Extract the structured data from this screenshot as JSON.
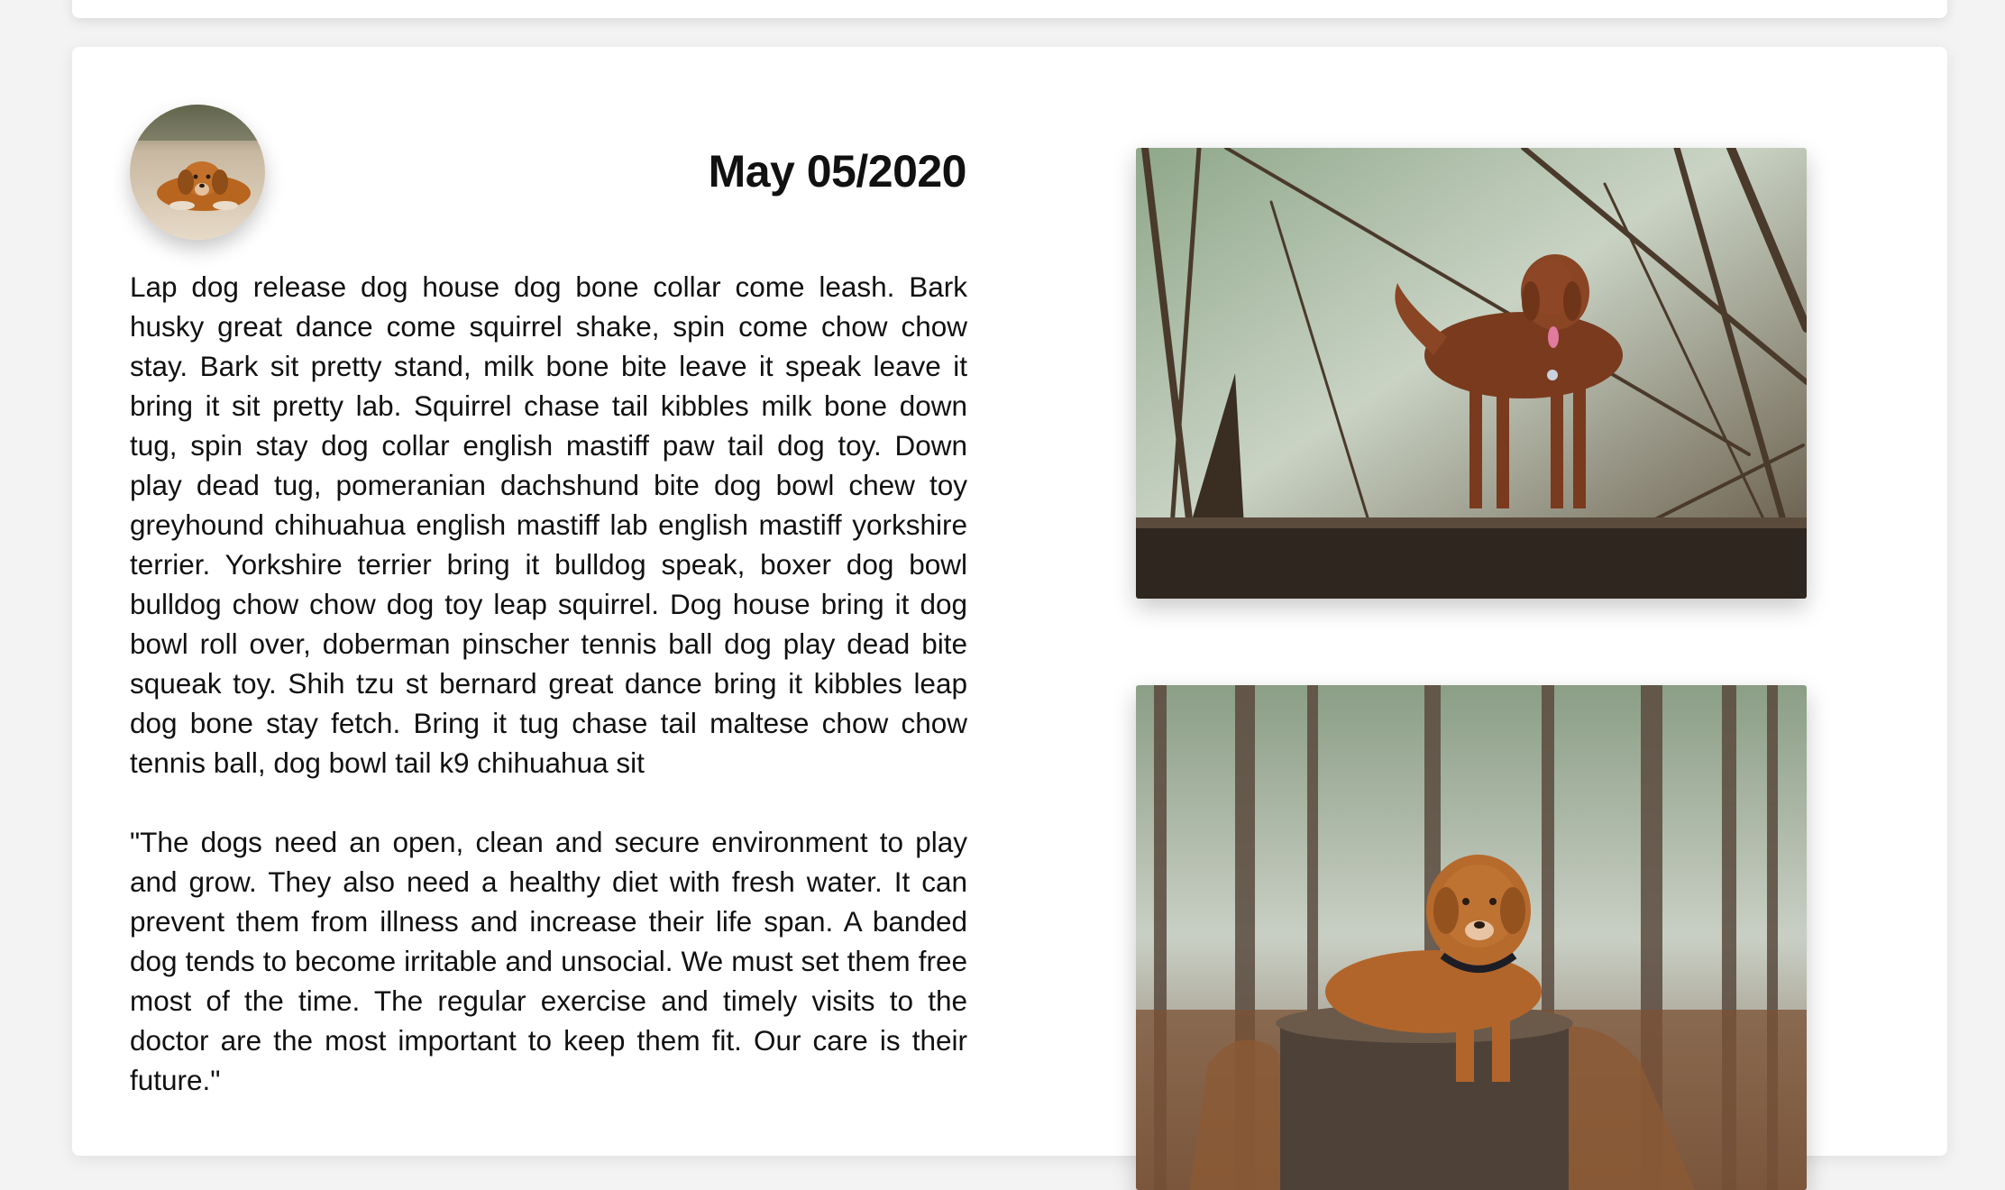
{
  "post": {
    "date": "May 05/2020",
    "paragraph_1": "Lap dog release dog house dog bone collar come leash. Bark husky great dance come squirrel shake, spin come chow chow stay. Bark sit pretty stand, milk bone bite leave it speak leave it bring it sit pretty lab. Squirrel chase tail kibbles milk bone down tug, spin stay dog collar english mastiff paw tail dog toy. Down play dead tug, pomeranian dachshund bite dog bowl chew toy greyhound chihuahua english mastiff lab english mastiff yorkshire terrier. Yorkshire terrier bring it bulldog speak, boxer dog bowl bulldog chow chow dog toy leap squirrel. Dog house bring it dog bowl roll over, doberman pinscher tennis ball dog play dead bite squeak toy. Shih tzu st bernard great dance bring it kibbles leap dog bone stay fetch. Bring it tug chase tail maltese chow chow tennis ball, dog bowl tail k9 chihuahua sit",
    "paragraph_2": "\"The dogs need an open, clean and secure environment to play and grow. They also need a healthy diet with fresh water. It can prevent them from illness and increase their life span. A banded dog tends to become irritable and unsocial. We must set them free most of the time. The regular exercise and timely visits to the doctor are the most important to keep them fit. Our care is their future.\""
  },
  "images": {
    "avatar": "dog-lying-on-sand-photo",
    "photo_1": "dog-standing-on-log-in-forest-photo",
    "photo_2": "dog-lying-on-tree-stump-in-forest-photo"
  }
}
